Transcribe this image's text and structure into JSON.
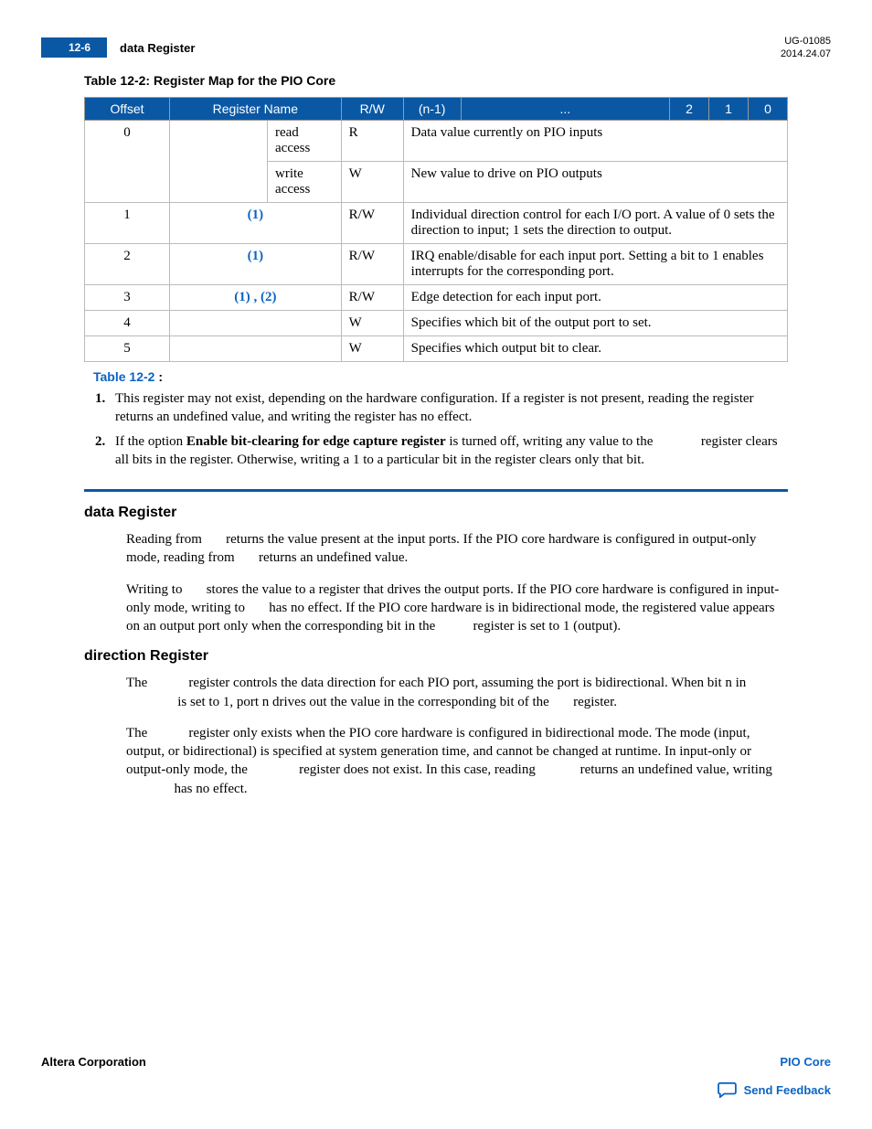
{
  "header": {
    "page_num": "12-6",
    "title": "data Register",
    "doc_id": "UG-01085",
    "date": "2014.24.07"
  },
  "table": {
    "caption": "Table 12-2: Register Map for the PIO Core",
    "head": {
      "offset": "Offset",
      "regname": "Register Name",
      "rw": "R/W",
      "n1": "(n-1)",
      "dots": "...",
      "b2": "2",
      "b1": "1",
      "b0": "0"
    },
    "rows": {
      "r0a": {
        "offset": "0",
        "name": "read access",
        "rw": "R",
        "desc": "Data value currently on PIO inputs"
      },
      "r0b": {
        "name": "write access",
        "rw": "W",
        "desc": "New value to drive on PIO outputs"
      },
      "r1": {
        "offset": "1",
        "link": "(1)",
        "rw": "R/W",
        "desc": "Individual direction control for each I/O port. A value of 0 sets the direction to input; 1 sets the direction to output."
      },
      "r2": {
        "offset": "2",
        "link": "(1)",
        "rw": "R/W",
        "desc": "IRQ enable/disable for each input port. Setting a bit to 1 enables interrupts for the corresponding port."
      },
      "r3": {
        "offset": "3",
        "link": "(1) , (2)",
        "rw": "R/W",
        "desc": "Edge detection for each input port."
      },
      "r4": {
        "offset": "4",
        "rw": "W",
        "desc": "Specifies which bit of the output port to set."
      },
      "r5": {
        "offset": "5",
        "rw": "W",
        "desc": "Specifies which output bit to clear."
      }
    }
  },
  "notes": {
    "header_link": "Table 12-2",
    "header_tail": " :",
    "n1_num": "1.",
    "n1": "This register may not exist, depending on the hardware configuration. If a register is not present, reading the register returns an undefined value, and writing the register has no effect.",
    "n2_num": "2.",
    "n2_pre": "If the option ",
    "n2_bold": "Enable bit-clearing for edge capture register",
    "n2_post": " is turned off, writing any value to the              register clears all bits in the register. Otherwise, writing a 1 to a particular bit in the register clears only that bit."
  },
  "sections": {
    "s1_title": "data Register",
    "s1_p1": "Reading from       returns the value present at the input ports. If the PIO core hardware is configured in output-only mode, reading from       returns an undefined value.",
    "s1_p2": "Writing to       stores the value to a register that drives the output ports. If the PIO core hardware is configured in input-only mode, writing to       has no effect. If the PIO core hardware is in bidirectional mode, the registered value appears on an output port only when the corresponding bit in the           register is set to 1 (output).",
    "s2_title": "direction Register",
    "s2_p1": "The            register controls the data direction for each PIO port, assuming the port is bidirectional. When bit n in                is set to 1, port n drives out the value in the corresponding bit of the       register.",
    "s2_p2": "The            register only exists when the PIO core hardware is configured in bidirectional mode. The mode (input, output, or bidirectional) is specified at system generation time, and cannot be changed at runtime. In input-only or output-only mode, the               register does not exist. In this case, reading             returns an undefined value, writing               has no effect."
  },
  "footer": {
    "left": "Altera Corporation",
    "right": "PIO Core",
    "feedback": "Send Feedback"
  }
}
